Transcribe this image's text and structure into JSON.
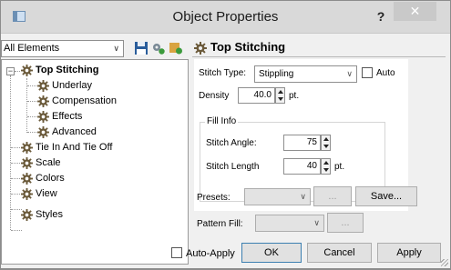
{
  "window": {
    "title": "Object Properties",
    "help_label": "?",
    "close_label": "✕"
  },
  "left": {
    "filter": {
      "selected": "All Elements"
    },
    "toolbar_icons": [
      "save-icon",
      "settings-icon",
      "apply-icon"
    ],
    "tree": [
      {
        "label": "Top Stitching",
        "level": 0,
        "expanded": true,
        "selected": true
      },
      {
        "label": "Underlay",
        "level": 1
      },
      {
        "label": "Compensation",
        "level": 1
      },
      {
        "label": "Effects",
        "level": 1
      },
      {
        "label": "Advanced",
        "level": 1
      },
      {
        "label": "Tie In And Tie Off",
        "level": 0
      },
      {
        "label": "Scale",
        "level": 0
      },
      {
        "label": "Colors",
        "level": 0
      },
      {
        "label": "View",
        "level": 0
      },
      {
        "label": "Styles",
        "level": 0
      }
    ]
  },
  "right": {
    "heading": "Top Stitching",
    "stitch_type": {
      "label": "Stitch Type:",
      "value": "Stippling",
      "auto_label": "Auto",
      "auto_checked": false
    },
    "density": {
      "label": "Density",
      "value": "40.0",
      "unit": "pt."
    },
    "fill_info": {
      "title": "Fill Info",
      "angle": {
        "label": "Stitch Angle:",
        "value": "75"
      },
      "length": {
        "label": "Stitch Length",
        "value": "40",
        "unit": "pt."
      }
    },
    "presets": {
      "label": "Presets:",
      "value": "",
      "browse_label": "...",
      "save_label": "Save..."
    },
    "pattern_fill": {
      "label": "Pattern Fill:",
      "value": "",
      "browse_label": "..."
    }
  },
  "footer": {
    "auto_apply_label": "Auto-Apply",
    "auto_apply_checked": false,
    "ok_label": "OK",
    "cancel_label": "Cancel",
    "apply_label": "Apply"
  },
  "colors": {
    "frame": "#8c8c8c",
    "titlebar": "#d9d9d9",
    "dialog_bg": "#f0f0f0",
    "close_button": "#c9c9c9",
    "default_button_border": "#3c7fb1"
  }
}
